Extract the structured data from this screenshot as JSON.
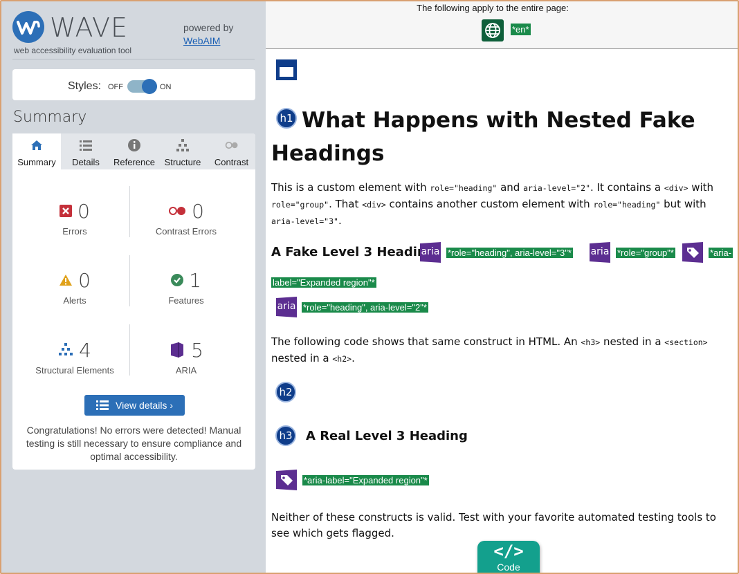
{
  "brand": {
    "name": "WAVE",
    "tagline": "web accessibility evaluation tool",
    "powered_by": "powered by",
    "webaim_link": "WebAIM"
  },
  "styles": {
    "label": "Styles:",
    "off": "OFF",
    "on": "ON"
  },
  "summary_heading": "Summary",
  "tabs": [
    {
      "label": "Summary",
      "icon": "home-icon",
      "active": true
    },
    {
      "label": "Details",
      "icon": "list-icon"
    },
    {
      "label": "Reference",
      "icon": "info-icon"
    },
    {
      "label": "Structure",
      "icon": "structure-icon"
    },
    {
      "label": "Contrast",
      "icon": "contrast-icon"
    }
  ],
  "stats": {
    "errors": {
      "value": "0",
      "label": "Errors"
    },
    "contrast": {
      "value": "0",
      "label": "Contrast Errors"
    },
    "alerts": {
      "value": "0",
      "label": "Alerts"
    },
    "features": {
      "value": "1",
      "label": "Features"
    },
    "structural": {
      "value": "4",
      "label": "Structural Elements"
    },
    "aria": {
      "value": "5",
      "label": "ARIA"
    }
  },
  "view_details": "View details ›",
  "congrats": "Congratulations! No errors were detected! Manual testing is still necessary to ensure compliance and optimal accessibility.",
  "topbar": {
    "text": "The following apply to the entire page:",
    "lang": "*en*"
  },
  "content": {
    "h1": "What Happens with Nested Fake Headings",
    "p1_parts": [
      "This is a custom element with ",
      "role=\"heading\"",
      " and ",
      "aria-level=\"2\"",
      ". It contains a ",
      "<div>",
      " with ",
      "role=\"group\"",
      ". That ",
      "<div>",
      " contains another custom element with ",
      "role=\"heading\"",
      " but with ",
      "aria-level=\"3\"",
      "."
    ],
    "fake_h3": "A Fake Level 3 Heading",
    "aria_label": "aria",
    "tag_role_h3": "*role=\"heading\", aria-level=\"3\"*",
    "tag_group": "*role=\"group\"*",
    "tag_aria_label_a": "*aria-",
    "tag_aria_label_b": "label=\"Expanded region\"*",
    "tag_role_h2": "*role=\"heading\", aria-level=\"2\"*",
    "p2_parts": [
      "The following code shows that same construct in HTML. An ",
      "<h3>",
      " nested in a ",
      "<section>",
      " nested in a ",
      "<h2>",
      "."
    ],
    "h2_badge": "h2",
    "h1_badge": "h1",
    "h3_badge": "h3",
    "real_h3": "A Real Level 3 Heading",
    "tag_expanded": "*aria-label=\"Expanded region\"*",
    "p3": "Neither of these constructs is valid. Test with your favorite automated testing tools to see which gets flagged.",
    "code_symbol": "</>",
    "code_label": "Code"
  }
}
